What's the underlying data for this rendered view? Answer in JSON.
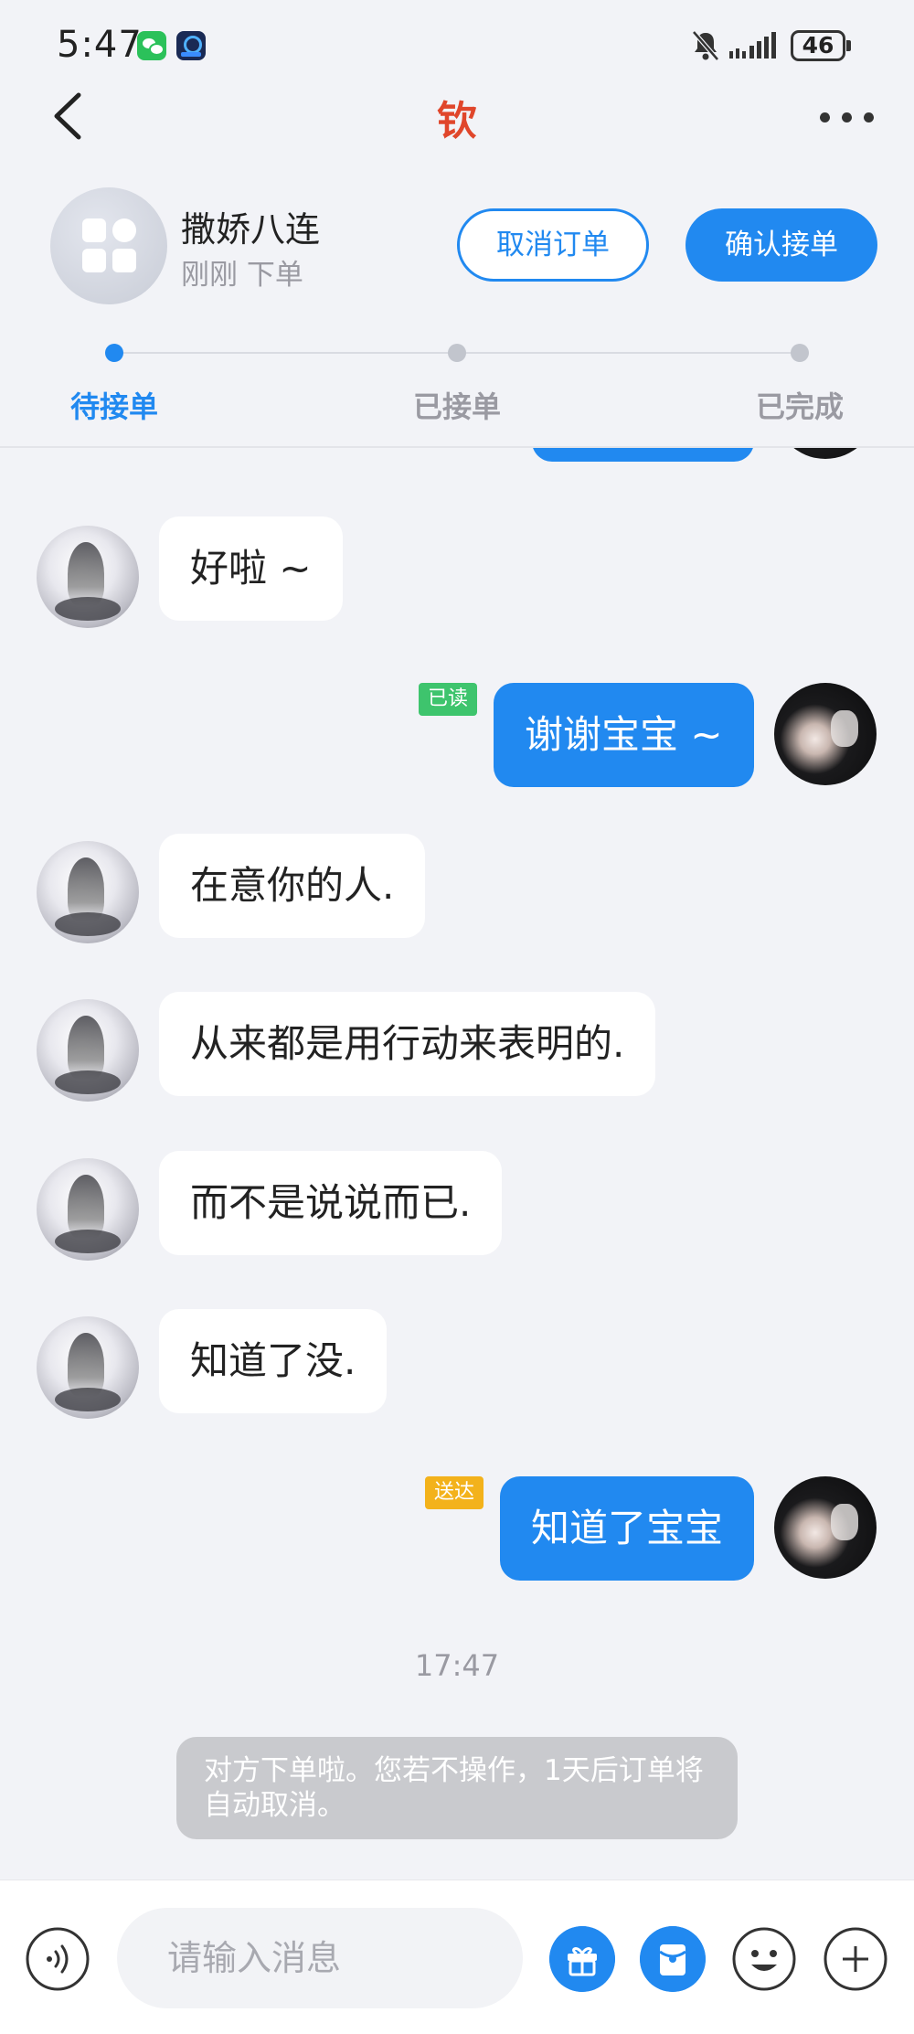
{
  "status_bar": {
    "time": "5:47",
    "battery": "46"
  },
  "nav": {
    "title": "钦"
  },
  "order": {
    "title": "撒娇八连",
    "subtitle": "刚刚 下单",
    "cancel_label": "取消订单",
    "confirm_label": "确认接单",
    "steps": [
      "待接单",
      "已接单",
      "已完成"
    ]
  },
  "messages": [
    {
      "side": "left",
      "text": "好啦 ~"
    },
    {
      "side": "right",
      "text": "谢谢宝宝 ~",
      "badge": "已读"
    },
    {
      "side": "left",
      "text": "在意你的人."
    },
    {
      "side": "left",
      "text": "从来都是用行动来表明的."
    },
    {
      "side": "left",
      "text": "而不是说说而已."
    },
    {
      "side": "left",
      "text": "知道了没."
    },
    {
      "side": "right",
      "text": "知道了宝宝",
      "badge": "送达"
    }
  ],
  "timestamp": "17:47",
  "system_notice": "对方下单啦。您若不操作，1天后订单将自动取消。",
  "input": {
    "placeholder": "请输入消息"
  },
  "colors": {
    "accent": "#2189f0",
    "title_red": "#e0462b",
    "read_badge": "#3ec46d",
    "delivered_badge": "#f3b21b"
  }
}
